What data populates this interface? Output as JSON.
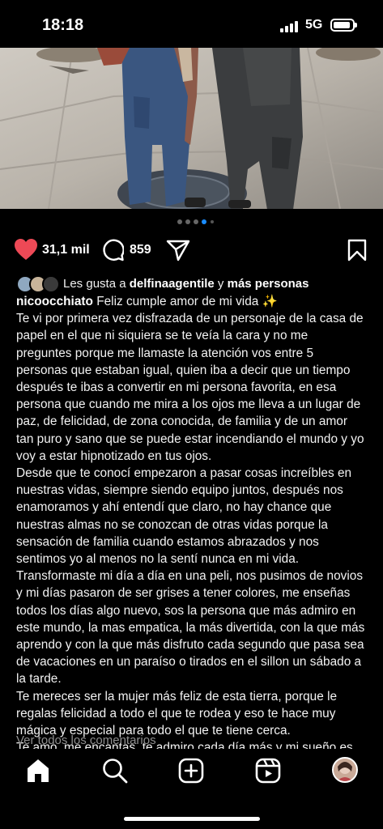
{
  "status": {
    "time": "18:18",
    "network": "5G"
  },
  "post": {
    "likes_count": "31,1 mil",
    "comments_count": "859",
    "liked_by_prefix": "Les gusta a ",
    "liked_by_user": "delfinaagentile",
    "liked_by_joiner": " y ",
    "liked_by_more": "más personas",
    "author": "nicoocchiato",
    "caption_title": "Feliz cumple amor de mi vida ✨",
    "paragraphs": [
      "Te vi por primera vez  disfrazada de un personaje de la casa de papel en el que ni siquiera se te veía la cara y no me preguntes porque me llamaste la atención vos entre 5 personas que estaban igual, quien iba a decir que un tiempo después te ibas a convertir en mi persona favorita, en esa persona que cuando me mira a los ojos me lleva a un lugar de paz, de felicidad, de zona conocida, de familia y de un amor tan puro y sano que se puede estar incendiando el mundo y yo voy a estar hipnotizado en tus ojos.",
      "Desde que te conocí empezaron a pasar cosas increíbles en nuestras vidas, siempre siendo equipo juntos, después nos enamoramos y ahí entendí que claro, no hay chance que nuestras almas no se conozcan de otras vidas porque la sensación de familia cuando estamos abrazados y nos sentimos yo al menos no la sentí nunca en mi vida.",
      "Transformaste mi día a día en una peli, nos pusimos de novios y mi días pasaron de ser grises a tener colores, me enseñas todos los días algo nuevo, sos la persona que más admiro en este mundo, la mas empatica, la más divertida, con la que más aprendo y con la que más disfruto cada segundo que pasa sea de vacaciones en un paraíso o tirados en el sillon un sábado a la tarde.",
      "Te mereces ser la mujer más feliz de esta tierra, porque le regalas felicidad a todo el que te rodea y eso te hace muy mágica y especial para todo el que te tiene cerca.",
      "Te amo, me encantas, te admiro cada día más y mi sueño es que seamos equipo para toda la vida ❤️"
    ],
    "view_all_comments": "Ver todos los comentarios",
    "carousel_pages": 5,
    "carousel_active": 4
  },
  "colors": {
    "like": "#ed4956",
    "background": "#000000",
    "muted": "#8e8e8e"
  },
  "icons": [
    "heart-icon",
    "comment-icon",
    "share-icon",
    "bookmark-icon",
    "home-icon",
    "search-icon",
    "create-icon",
    "reels-icon",
    "profile-avatar"
  ]
}
